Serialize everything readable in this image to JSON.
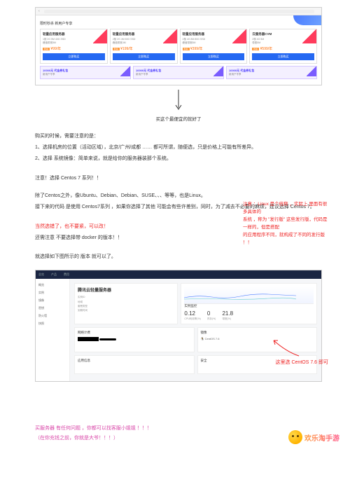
{
  "pricing": {
    "tab_header": "限时秒杀 新用户专享",
    "cards": [
      {
        "title": "轻量应用服务器",
        "spec1": "1核 2G 5M 40G SSD",
        "spec2": "峰值带宽5M",
        "price": "¥99/年",
        "tag": "秒杀"
      },
      {
        "title": "轻量应用服务器",
        "spec1": "2核 2G 4M 60G SSD",
        "spec2": "峰值带宽4M",
        "price": "¥199/年",
        "tag": "秒杀"
      },
      {
        "title": "轻量应用服务器",
        "spec1": "2核 4G 8M 80G SSD",
        "spec2": "峰值带宽8M",
        "price": "¥399/年",
        "tag": "秒杀"
      },
      {
        "title": "云服务器CVM",
        "spec1": "2核 4G 5M",
        "spec2": "带宽5M",
        "price": "¥599/年",
        "tag": "秒杀"
      }
    ],
    "buy_label": "立即购买",
    "banners": [
      {
        "title": "10000元 代金券礼包",
        "sub": "新用户专享"
      },
      {
        "title": "10000元 代金券礼包",
        "sub": "新用户专享"
      },
      {
        "title": "10000元 代金券礼包",
        "sub": "新用户专享"
      }
    ]
  },
  "caption1": "买这个最便宜的就好了",
  "text": {
    "p1": "购买的时候，需要注意的是：",
    "p2": "1、选择机房的位置（活动区域），北京/广州/成都 …… 都可所谓，随便选，只是价格上可能有所差异。",
    "p3": "2、选择 系统镜像：简单来说，就是给你的服务器装那个系统。",
    "p4": "注意！选择 Centos 7 系列！！",
    "p5": "除了Centos之外，像Ubuntu、Debian、Debian、SUSE、、、等等，也是Linux。",
    "p6": "接下来的代码 是使用 Centos7系列 ，如果你选择了其他 可能会有些许差别，同时，为了减去不必要的麻烦，建议选择 Centos 7。",
    "p7": "当然选错了，也不要紧，可以改！",
    "p8": "还需注意 不要选择带 docker 的版本！！",
    "p9": "就选择如下图所示的 版本 就可以了。"
  },
  "red_note": {
    "l1": "注意 ：Linux 是个统称 ，实际上 里面有很多具体的",
    "l2": "系统 ，称为 \"发行版\" 这些发行版，代码是一样的，但是搭配",
    "l3": "的应用程序不同，就构成了不同的发行版 ！！"
  },
  "dashboard": {
    "nav": [
      "总览",
      "产品",
      "费用"
    ],
    "side": [
      "概览",
      "实例",
      "镜像",
      "密钥",
      "防火墙",
      "快照"
    ],
    "server_ip": "腾讯云轻量服务器",
    "info_labels": [
      "实例ID",
      "地域",
      "套餐类型",
      "到期时间"
    ],
    "monitor_title": "实例监控",
    "stats": [
      {
        "val": "0.12",
        "lbl": "CPU利用率(%)"
      },
      {
        "val": "0",
        "lbl": "内存(%)"
      },
      {
        "val": "21.8",
        "lbl": "带宽(%)"
      }
    ],
    "image_card_title": "镜像",
    "image_line": "CentOS 7.6",
    "net_title": "网络计费",
    "app_title": "应用信息",
    "sec_title": "安全"
  },
  "callout2": "这里选 CentOS 7.6 即可",
  "footer": {
    "l1": "买服务器 有任何问题 ，你都可以找客服小姐姐 ！！！",
    "l2": "（在你充钱之前，你就是大爷！！！）"
  },
  "brand": "欢乐淘手游"
}
